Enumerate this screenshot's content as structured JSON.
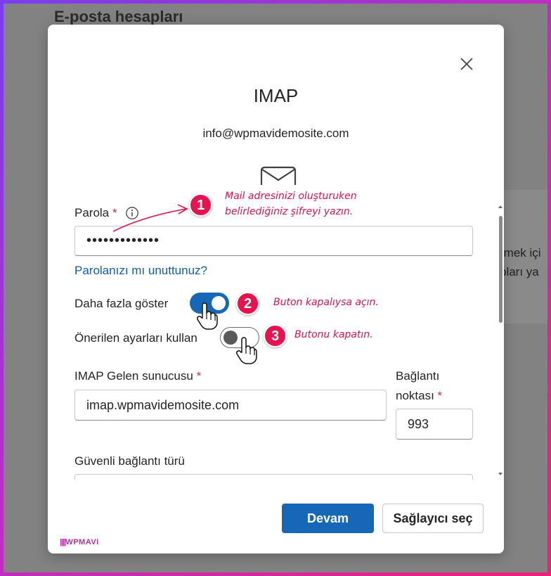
{
  "background": {
    "title": "E-posta hesapları",
    "line1": "rmek içi",
    "line2": "pları ya"
  },
  "dialog": {
    "title": "IMAP",
    "email": "info@wpmavidemosite.com",
    "password": {
      "label": "Parola",
      "required_mark": "*",
      "value": "•••••••••••••"
    },
    "forgot_link": "Parolanızı mı unuttunuz?",
    "show_more": {
      "label": "Daha fazla göster",
      "on": true
    },
    "recommended": {
      "label": "Önerilen ayarları kullan",
      "on": false
    },
    "imap_server": {
      "label": "IMAP Gelen sunucusu",
      "required_mark": "*",
      "value": "imap.wpmavidemosite.com"
    },
    "port": {
      "label_line1": "Bağlantı",
      "label_line2": "noktası",
      "required_mark": "*",
      "value": "993"
    },
    "secure_connection_label": "Güvenli bağlantı türü",
    "buttons": {
      "continue": "Devam",
      "choose_provider": "Sağlayıcı seç"
    }
  },
  "annotations": [
    {
      "number": "1",
      "text_line1": "Mail adresinizi oluşturuken",
      "text_line2": "belirlediğiniz şifreyi yazın."
    },
    {
      "number": "2",
      "text": "Buton kapalıysa açın."
    },
    {
      "number": "3",
      "text": "Butonu kapatın."
    }
  ],
  "brand": "WPMAVI",
  "colors": {
    "primary": "#1667b8",
    "annotation": "#e8124f",
    "link": "#115ea3"
  }
}
